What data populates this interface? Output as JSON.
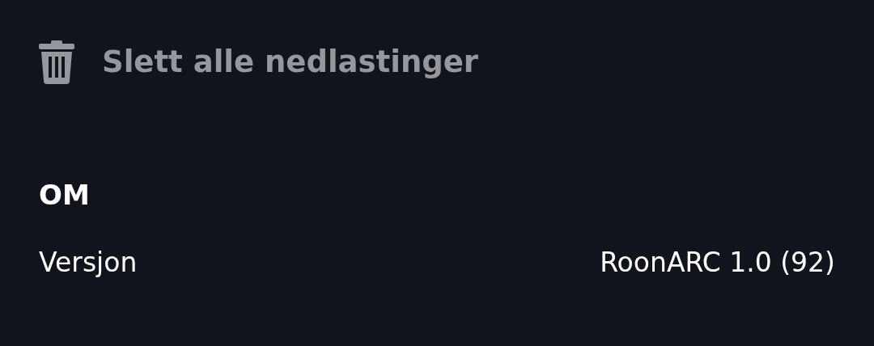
{
  "actions": [
    {
      "label": "Slett alle nedlastinger",
      "disabled": true
    }
  ],
  "sections": [
    {
      "heading": "OM",
      "rows": [
        {
          "label": "Versjon",
          "value": "RoonARC 1.0 (92)"
        }
      ]
    }
  ]
}
